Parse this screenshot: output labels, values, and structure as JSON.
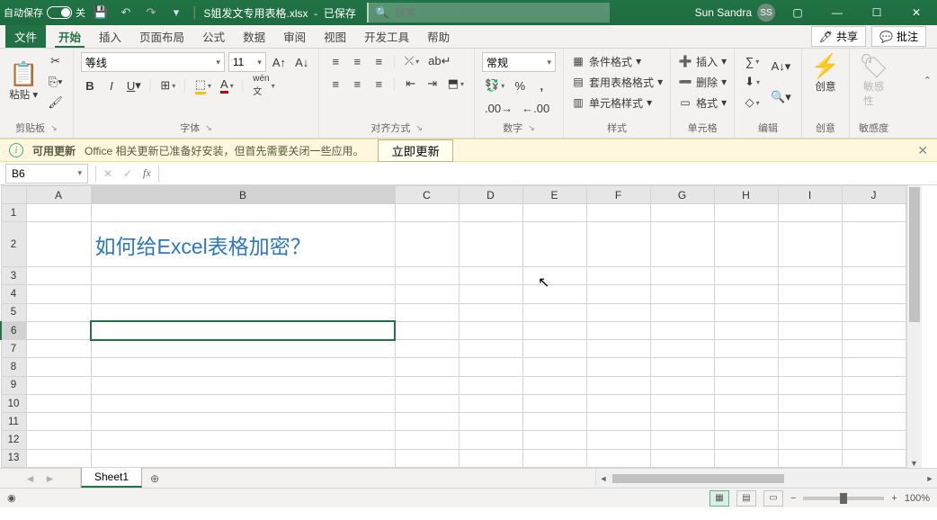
{
  "titlebar": {
    "autosave": "自动保存",
    "autosave_state": "关",
    "filename": "S姐发文专用表格.xlsx",
    "saved": "已保存",
    "search_placeholder": "搜索",
    "username": "Sun Sandra",
    "initials": "SS"
  },
  "tabs": {
    "file": "文件",
    "home": "开始",
    "insert": "插入",
    "layout": "页面布局",
    "formulas": "公式",
    "data": "数据",
    "review": "审阅",
    "view": "视图",
    "dev": "开发工具",
    "help": "帮助",
    "share": "共享",
    "comments": "批注"
  },
  "ribbon": {
    "clipboard": {
      "label": "剪贴板",
      "paste": "粘贴"
    },
    "font": {
      "label": "字体",
      "name": "等线",
      "size": "11"
    },
    "align": {
      "label": "对齐方式"
    },
    "number": {
      "label": "数字",
      "format": "常规"
    },
    "styles": {
      "label": "样式",
      "cond": "条件格式",
      "table": "套用表格格式",
      "cell": "单元格样式"
    },
    "cells": {
      "label": "单元格",
      "insert": "插入",
      "delete": "删除",
      "format": "格式"
    },
    "editing": {
      "label": "编辑"
    },
    "ideas": {
      "label": "创意",
      "btn": "创意"
    },
    "sens": {
      "label": "敏感度",
      "btn": "敏感\n性"
    }
  },
  "msgbar": {
    "title": "可用更新",
    "text": "Office 相关更新已准备好安装，但首先需要关闭一些应用。",
    "btn": "立即更新"
  },
  "formula": {
    "cell": "B6"
  },
  "grid": {
    "cols": [
      "A",
      "B",
      "C",
      "D",
      "E",
      "F",
      "G",
      "H",
      "I",
      "J"
    ],
    "rows": [
      1,
      2,
      3,
      4,
      5,
      6,
      7,
      8,
      9,
      10,
      11,
      12,
      13
    ],
    "active": "B6",
    "b2": "如何给Excel表格加密？"
  },
  "sheets": {
    "s1": "Sheet1"
  },
  "status": {
    "zoom": "100%"
  }
}
